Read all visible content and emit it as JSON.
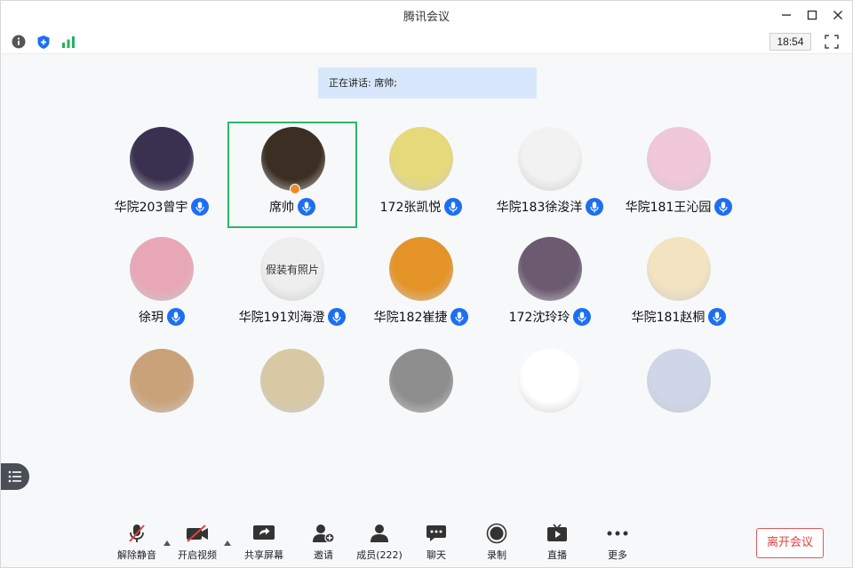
{
  "window": {
    "title": "腾讯会议"
  },
  "subbar": {
    "clock": "18:54"
  },
  "speaking": {
    "text": "正在讲话: 席帅;"
  },
  "participants": [
    {
      "name": "华院203曾宇",
      "avatar_color": "#3a3050",
      "mic": true
    },
    {
      "name": "席帅",
      "avatar_color": "#3b2e22",
      "mic": true,
      "active": true
    },
    {
      "name": "172张凯悦",
      "avatar_color": "#e6d97a",
      "mic": true
    },
    {
      "name": "华院183徐浚洋",
      "avatar_color": "#f2f2f2",
      "mic": true
    },
    {
      "name": "华院181王沁园",
      "avatar_color": "#f0c8d8",
      "mic": true
    },
    {
      "name": "徐玥",
      "avatar_color": "#e7a7b6",
      "mic": true
    },
    {
      "name": "华院191刘海澄",
      "avatar_color": "#eeeeee",
      "mic": true,
      "avatar_text": "假装有照片"
    },
    {
      "name": "华院182崔捷",
      "avatar_color": "#e49427",
      "mic": true
    },
    {
      "name": "172沈玲玲",
      "avatar_color": "#6b5a70",
      "mic": true
    },
    {
      "name": "华院181赵桐",
      "avatar_color": "#f3e3c0",
      "mic": true
    },
    {
      "name": "",
      "avatar_color": "#c9a27a"
    },
    {
      "name": "",
      "avatar_color": "#d8c9a4"
    },
    {
      "name": "",
      "avatar_color": "#8e8e8e"
    },
    {
      "name": "",
      "avatar_color": "#ffffff"
    },
    {
      "name": "",
      "avatar_color": "#cfd6e8"
    }
  ],
  "toolbar": {
    "unmute": "解除静音",
    "video": "开启视频",
    "share": "共享屏幕",
    "invite": "邀请",
    "members": "成员(222)",
    "chat": "聊天",
    "record": "录制",
    "live": "直播",
    "more": "更多",
    "leave": "离开会议"
  },
  "colors": {
    "accent": "#1d6ff2",
    "active_border": "#2db46f",
    "leave": "#e0423e",
    "banner": "#d8e7fb"
  }
}
